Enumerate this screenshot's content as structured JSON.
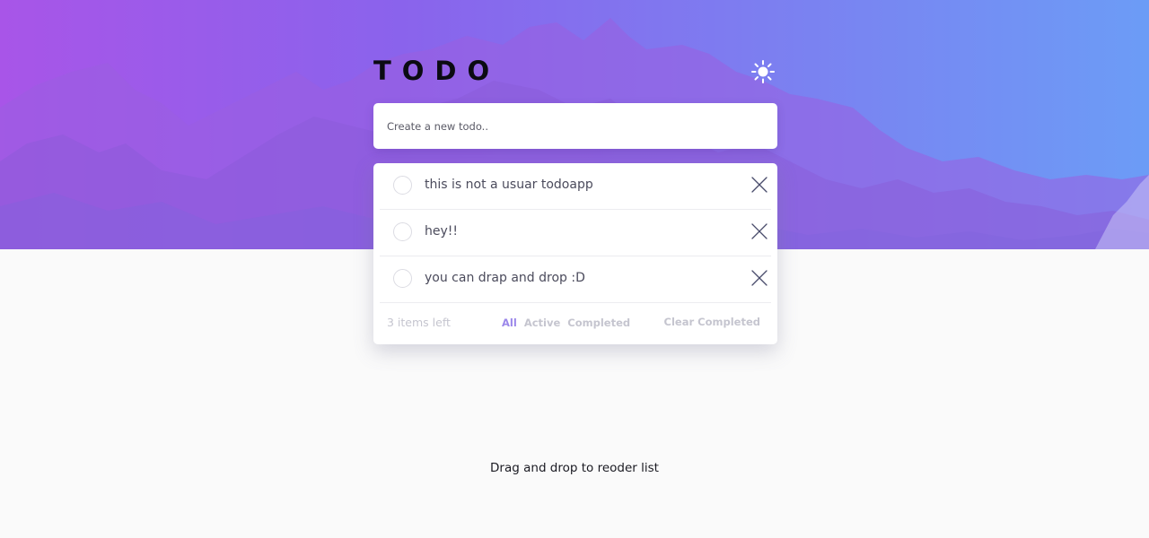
{
  "colors": {
    "gradient_start": "#a855e8",
    "gradient_end": "#6c9cf6",
    "filter_active": "#9b87ea",
    "muted_text": "#c5c5cf"
  },
  "header": {
    "title": "TODO",
    "theme_toggle_icon": "sun-icon"
  },
  "new_todo": {
    "placeholder": "Create a new todo.."
  },
  "todos": [
    {
      "text": "this is not a usuar todoapp",
      "completed": false
    },
    {
      "text": "hey!!",
      "completed": false
    },
    {
      "text": "you can drap and drop :D",
      "completed": false
    }
  ],
  "footer": {
    "items_left": "3 items left",
    "filters": [
      "All",
      "Active",
      "Completed"
    ],
    "active_filter": "All",
    "clear_label": "Clear Completed"
  },
  "hint": "Drag and drop to reoder list"
}
